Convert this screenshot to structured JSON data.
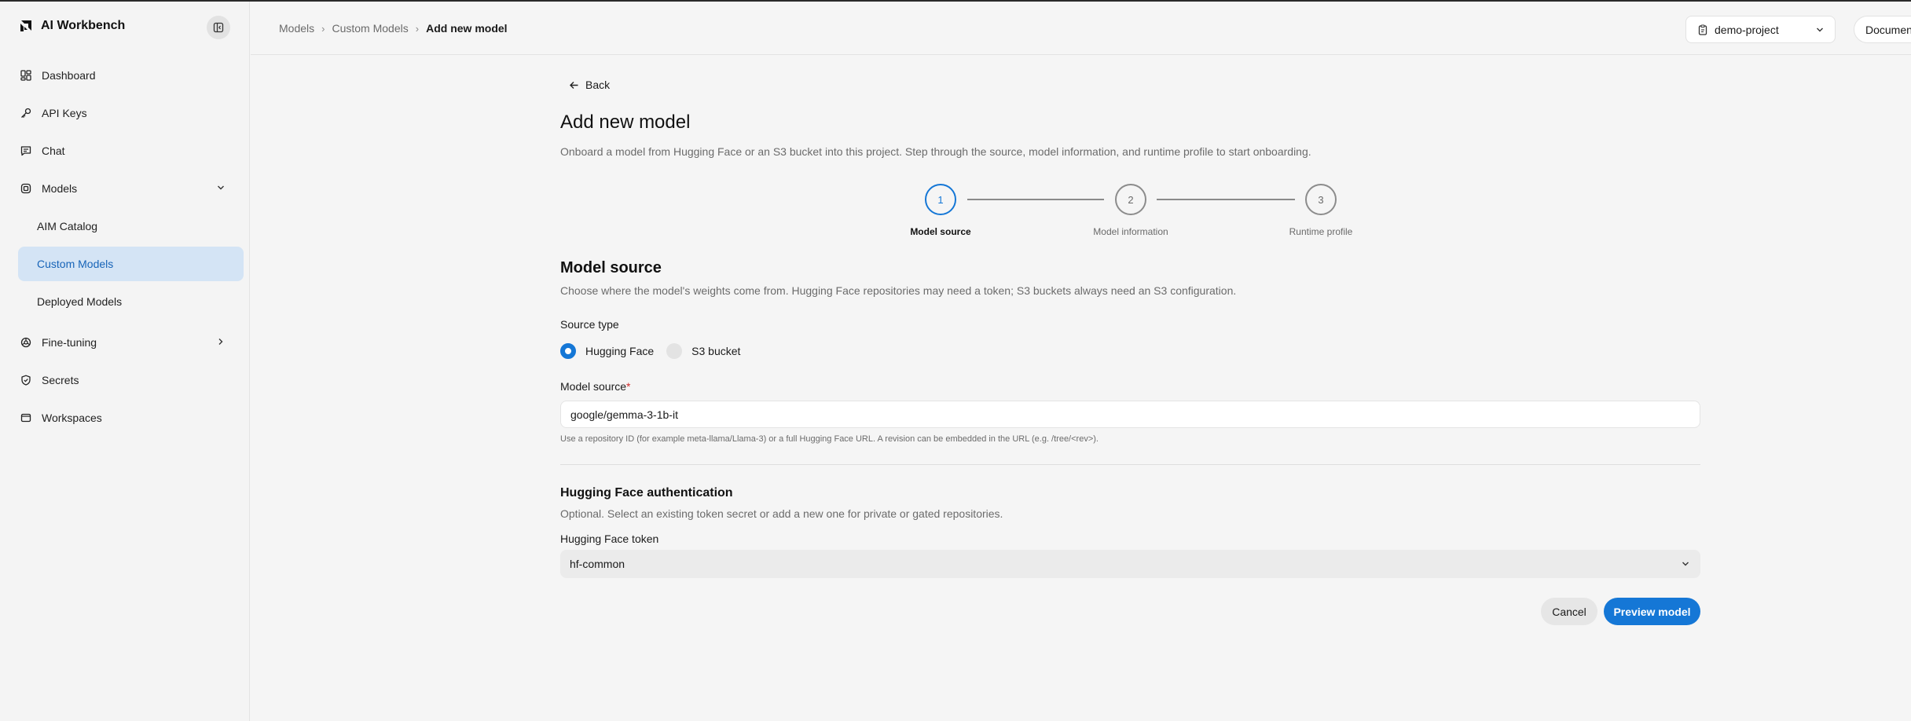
{
  "app": {
    "name": "AI Workbench"
  },
  "sidebar": {
    "items": [
      {
        "label": "Dashboard",
        "icon": "dashboard-icon"
      },
      {
        "label": "API Keys",
        "icon": "key-icon"
      },
      {
        "label": "Chat",
        "icon": "chat-icon"
      },
      {
        "label": "Models",
        "icon": "models-icon",
        "expanded": true
      },
      {
        "label": "AIM Catalog"
      },
      {
        "label": "Custom Models",
        "active": true
      },
      {
        "label": "Deployed Models"
      },
      {
        "label": "Fine-tuning",
        "icon": "fine-tuning-icon"
      },
      {
        "label": "Secrets",
        "icon": "shield-icon"
      },
      {
        "label": "Workspaces",
        "icon": "workspace-icon"
      }
    ]
  },
  "header": {
    "breadcrumb": [
      "Models",
      "Custom Models",
      "Add new model"
    ],
    "project": "demo-project",
    "docs_label": "Documentation"
  },
  "page": {
    "back_label": "Back",
    "title": "Add new model",
    "description": "Onboard a model from Hugging Face or an S3 bucket into this project. Step through the source, model information, and runtime profile to start onboarding."
  },
  "stepper": {
    "steps": [
      {
        "number": "1",
        "label": "Model source",
        "active": true
      },
      {
        "number": "2",
        "label": "Model information"
      },
      {
        "number": "3",
        "label": "Runtime profile"
      }
    ]
  },
  "source_section": {
    "title": "Model source",
    "description": "Choose where the model's weights come from. Hugging Face repositories may need a token; S3 buckets always need an S3 configuration.",
    "source_type_label": "Source type",
    "options": [
      {
        "label": "Hugging Face",
        "selected": true
      },
      {
        "label": "S3 bucket",
        "selected": false
      }
    ],
    "model_source_label": "Model source",
    "required_mark": "*",
    "model_source_value": "google/gemma-3-1b-it",
    "help_text": "Use a repository ID (for example meta-llama/Llama-3) or a full Hugging Face URL. A revision can be embedded in the URL (e.g. /tree/<rev>)."
  },
  "auth_section": {
    "title": "Hugging Face authentication",
    "description": "Optional. Select an existing token secret or add a new one for private or gated repositories.",
    "token_label": "Hugging Face token",
    "token_value": "hf-common"
  },
  "actions": {
    "cancel_label": "Cancel",
    "primary_label": "Preview model"
  },
  "colors": {
    "accent": "#1577d6",
    "active_nav_bg": "#d4e4f5",
    "required": "#d12b2b"
  }
}
